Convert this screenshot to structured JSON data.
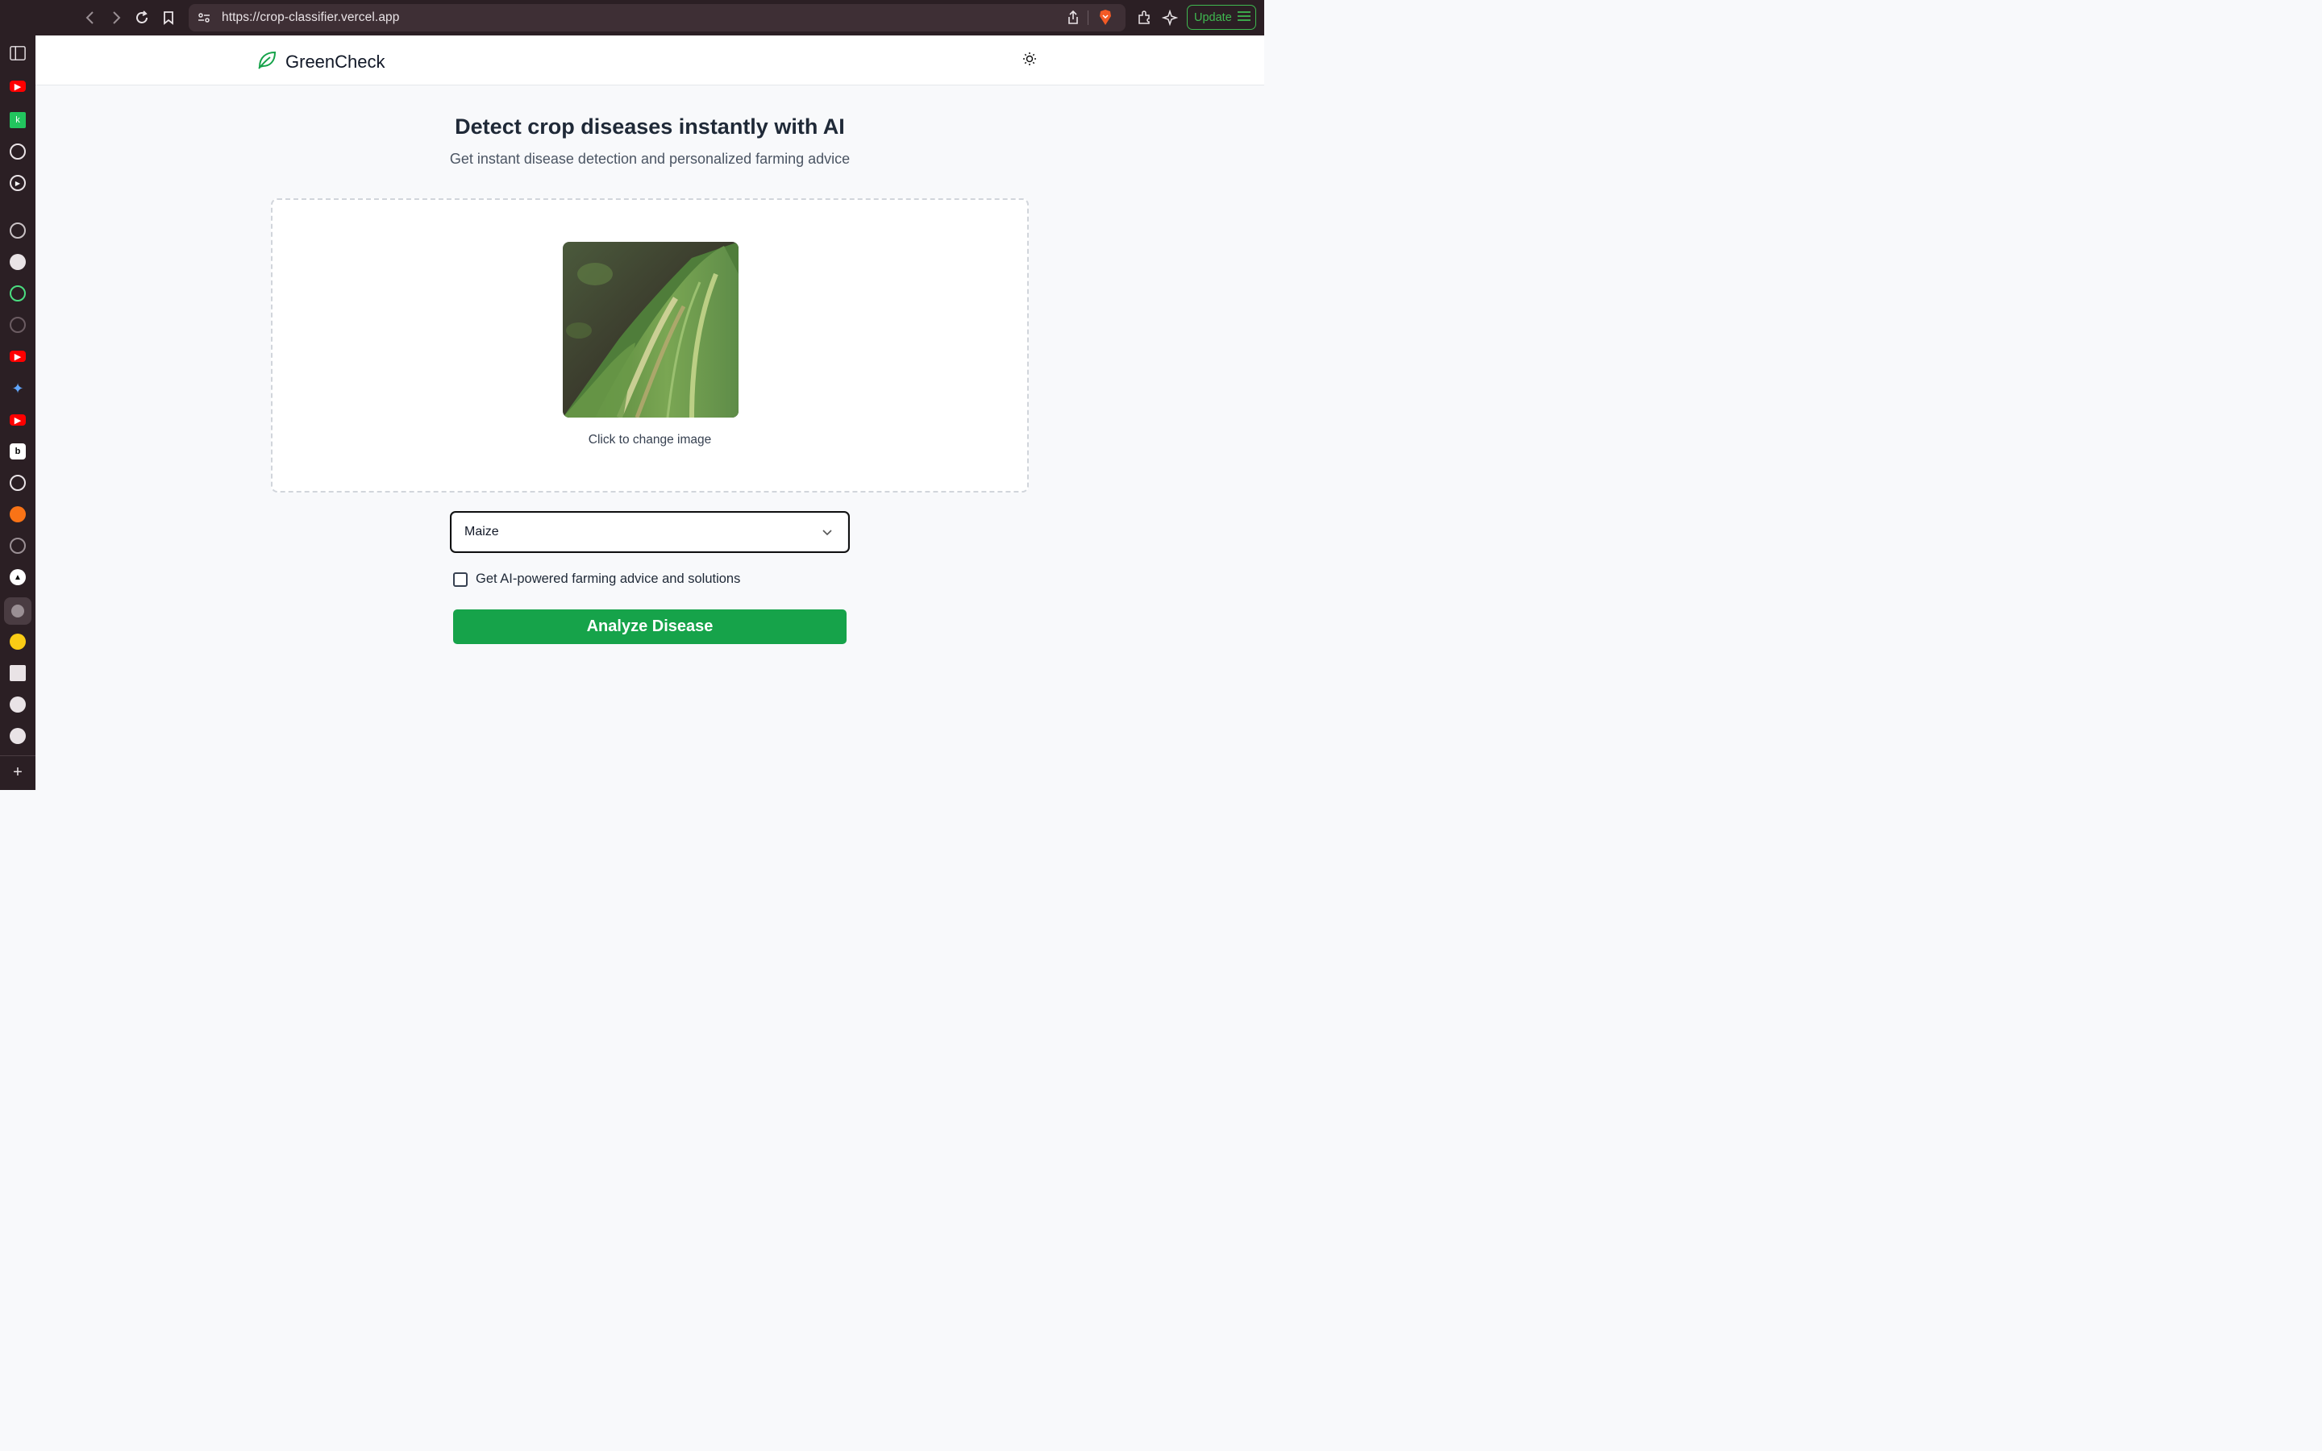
{
  "browser": {
    "url": "https://crop-classifier.vercel.app",
    "update_label": "Update"
  },
  "sidebar": {
    "icons": [
      "sidebar-toggle-icon",
      "youtube-icon",
      "app-icon",
      "chatgpt-icon",
      "play-icon",
      "github-icon",
      "github-icon",
      "app-icon",
      "settings-icon",
      "youtube-icon",
      "gemini-icon",
      "youtube-icon",
      "bing-icon",
      "chatgpt-icon",
      "app-icon",
      "app-icon",
      "vercel-icon",
      "globe-icon",
      "app-icon",
      "app-icon",
      "app-icon",
      "app-icon",
      "add-icon"
    ]
  },
  "header": {
    "brand": "GreenCheck"
  },
  "main": {
    "headline": "Detect crop diseases instantly with AI",
    "subheadline": "Get instant disease detection and personalized farming advice",
    "change_image_label": "Click to change image",
    "crop_select_value": "Maize",
    "advice_checkbox_label": "Get AI-powered farming advice and solutions",
    "analyze_button": "Analyze Disease"
  },
  "colors": {
    "accent": "#16a34a",
    "chrome": "#2b1f24"
  }
}
